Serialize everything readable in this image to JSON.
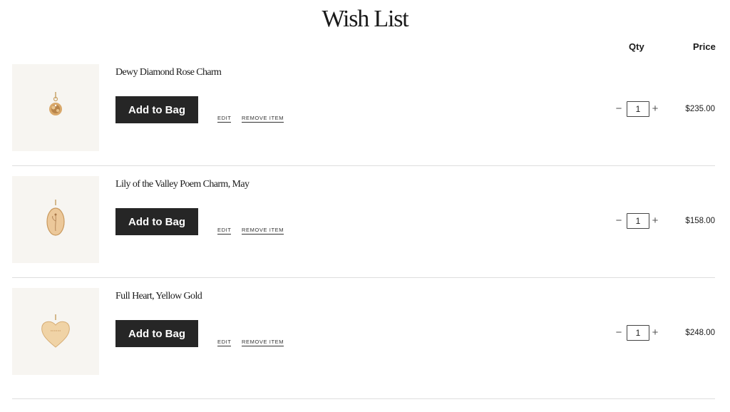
{
  "page": {
    "title": "Wish List"
  },
  "columns": {
    "qty": "Qty",
    "price": "Price"
  },
  "items": [
    {
      "name": "Dewy Diamond Rose Charm",
      "add_label": "Add to Bag",
      "edit_label": "EDIT",
      "remove_label": "REMOVE ITEM",
      "qty": "1",
      "minus": "−",
      "plus": "+",
      "price": "$235.00",
      "image_icon": "rose-charm-icon"
    },
    {
      "name": "Lily of the Valley Poem Charm, May",
      "add_label": "Add to Bag",
      "edit_label": "EDIT",
      "remove_label": "REMOVE ITEM",
      "qty": "1",
      "minus": "−",
      "plus": "+",
      "price": "$158.00",
      "image_icon": "oval-lily-charm-icon"
    },
    {
      "name": "Full Heart, Yellow Gold",
      "add_label": "Add to Bag",
      "edit_label": "EDIT",
      "remove_label": "REMOVE ITEM",
      "qty": "1",
      "minus": "−",
      "plus": "+",
      "price": "$248.00",
      "image_icon": "heart-charm-icon"
    }
  ],
  "colors": {
    "button_bg": "#262626",
    "thumb_bg": "#f7f5f1",
    "gold": "#d9b07a"
  }
}
